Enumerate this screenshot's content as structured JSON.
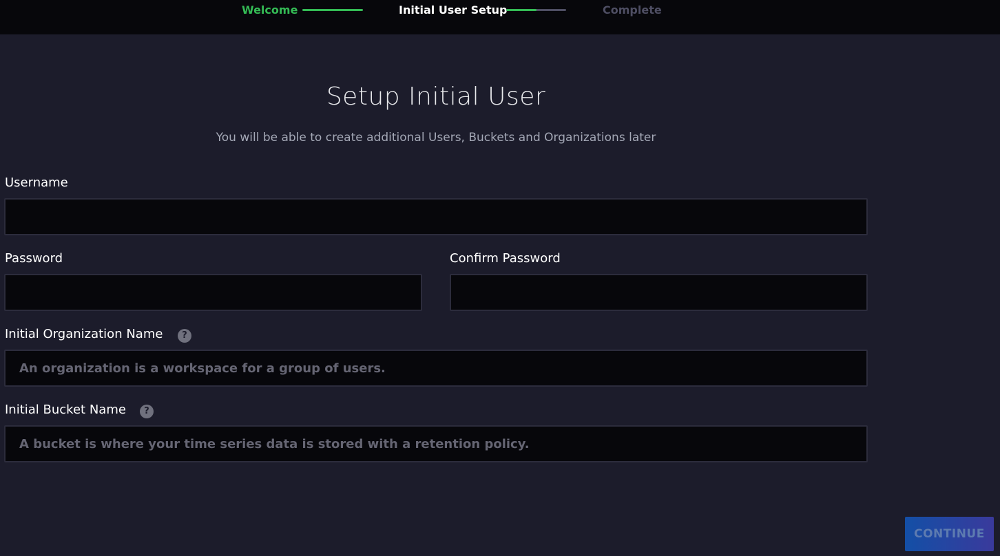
{
  "stepper": {
    "steps": [
      {
        "label": "Welcome",
        "status": "done"
      },
      {
        "label": "Initial User Setup",
        "status": "active"
      },
      {
        "label": "Complete",
        "status": "pending"
      }
    ],
    "connector_progress": [
      1.0,
      0.5
    ]
  },
  "header": {
    "title": "Setup Initial User",
    "subtitle": "You will be able to create additional Users, Buckets and Organizations later"
  },
  "form": {
    "username": {
      "label": "Username",
      "value": "",
      "placeholder": ""
    },
    "password": {
      "label": "Password",
      "value": "",
      "placeholder": ""
    },
    "confirm_password": {
      "label": "Confirm Password",
      "value": "",
      "placeholder": ""
    },
    "org_name": {
      "label": "Initial Organization Name",
      "value": "",
      "placeholder": "An organization is a workspace for a group of users."
    },
    "bucket_name": {
      "label": "Initial Bucket Name",
      "value": "",
      "placeholder": "A bucket is where your time series data is stored with a retention policy."
    },
    "help_icon_glyph": "?"
  },
  "actions": {
    "continue_label": "CONTINUE"
  },
  "colors": {
    "background": "#1c1c2b",
    "topbar": "#07070b",
    "accent_green": "#34bb55",
    "input_bg": "#07070b",
    "button_gradient_start": "#134fa6",
    "button_gradient_end": "#3a3a9c"
  }
}
